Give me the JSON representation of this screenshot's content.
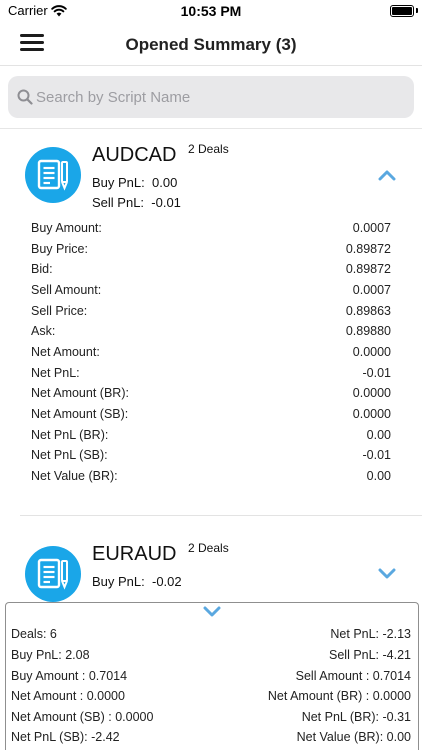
{
  "status_bar": {
    "carrier": "Carrier",
    "time": "10:53 PM"
  },
  "header": {
    "title": "Opened Summary (3)"
  },
  "search": {
    "placeholder": "Search by Script Name"
  },
  "cards": [
    {
      "symbol": "AUDCAD",
      "deals": "2 Deals",
      "buy_pnl_label": "Buy PnL:",
      "buy_pnl": "0.00",
      "sell_pnl_label": "Sell PnL:",
      "sell_pnl": "-0.01",
      "expanded": true,
      "details": [
        {
          "label": "Buy Amount:",
          "value": "0.0007"
        },
        {
          "label": "Buy Price:",
          "value": "0.89872"
        },
        {
          "label": "Bid:",
          "value": "0.89872"
        },
        {
          "label": "Sell Amount:",
          "value": "0.0007"
        },
        {
          "label": "Sell Price:",
          "value": "0.89863"
        },
        {
          "label": "Ask:",
          "value": "0.89880"
        },
        {
          "label": "Net Amount:",
          "value": "0.0000"
        },
        {
          "label": "Net PnL:",
          "value": "-0.01"
        },
        {
          "label": "Net Amount (BR):",
          "value": "0.0000"
        },
        {
          "label": "Net Amount (SB):",
          "value": "0.0000"
        },
        {
          "label": "Net PnL (BR):",
          "value": "0.00"
        },
        {
          "label": "Net PnL (SB):",
          "value": "-0.01"
        },
        {
          "label": "Net Value (BR):",
          "value": "0.00"
        }
      ]
    },
    {
      "symbol": "EURAUD",
      "deals": "2 Deals",
      "buy_pnl_label": "Buy PnL:",
      "buy_pnl": "-0.02",
      "expanded": false
    }
  ],
  "summary": {
    "rows": [
      {
        "left": "Deals: 6",
        "right": "Net PnL:  -2.13"
      },
      {
        "left": "Buy PnL:  2.08",
        "right": "Sell PnL:  -4.21"
      },
      {
        "left": "Buy Amount : 0.7014",
        "right": "Sell Amount : 0.7014"
      },
      {
        "left": "Net Amount : 0.0000",
        "right": "Net Amount (BR) : 0.0000"
      },
      {
        "left": "Net Amount (SB) : 0.0000",
        "right": "Net PnL (BR):  -0.31"
      },
      {
        "left": "Net PnL (SB):  -2.42",
        "right": "Net Value (BR):  0.00"
      }
    ]
  },
  "colors": {
    "accent": "#1aa6e8",
    "chevron": "#5aa8e0"
  }
}
